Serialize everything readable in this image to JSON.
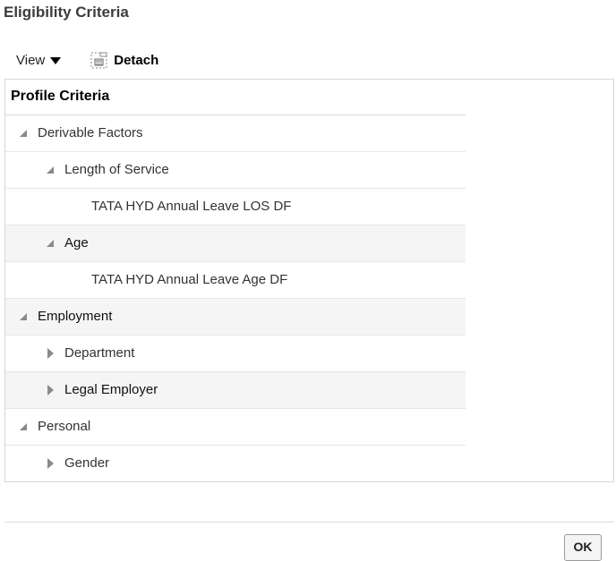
{
  "page": {
    "title": "Eligibility Criteria"
  },
  "toolbar": {
    "view_label": "View",
    "detach_label": "Detach"
  },
  "tree": {
    "header": "Profile Criteria",
    "rows": [
      {
        "label": "Derivable Factors",
        "level": 0,
        "state": "expanded"
      },
      {
        "label": "Length of Service",
        "level": 1,
        "state": "expanded"
      },
      {
        "label": "TATA HYD Annual Leave LOS DF",
        "level": 2,
        "state": "leaf"
      },
      {
        "label": "Age",
        "level": 1,
        "state": "expanded"
      },
      {
        "label": "TATA HYD Annual Leave Age DF",
        "level": 2,
        "state": "leaf"
      },
      {
        "label": "Employment",
        "level": 0,
        "state": "expanded"
      },
      {
        "label": "Department",
        "level": 1,
        "state": "collapsed"
      },
      {
        "label": "Legal Employer",
        "level": 1,
        "state": "collapsed"
      },
      {
        "label": "Personal",
        "level": 0,
        "state": "expanded"
      },
      {
        "label": "Gender",
        "level": 1,
        "state": "collapsed"
      }
    ]
  },
  "footer": {
    "ok_label": "OK"
  }
}
